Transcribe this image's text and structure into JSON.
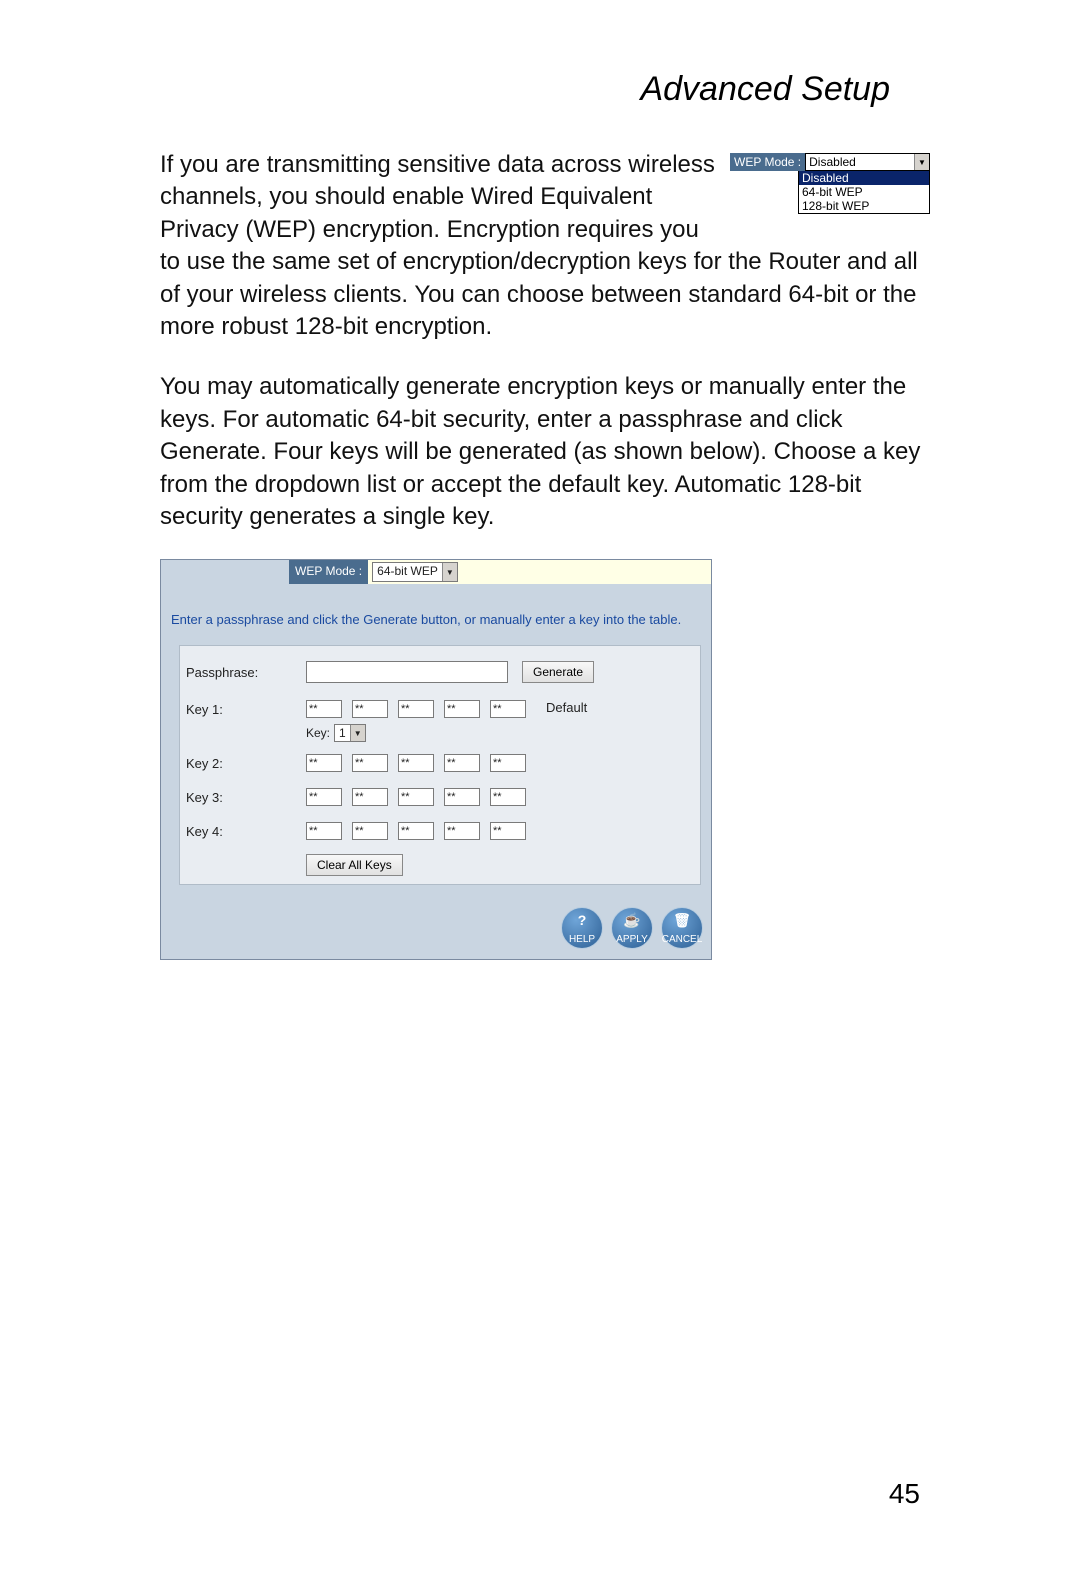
{
  "title": "Advanced Setup",
  "para1": "If you are transmitting sensitive data across wireless channels, you should enable Wired Equivalent Privacy (WEP) encryption. Encryption requires you to use the same set of encryption/decryption keys for the Router and all of your wireless clients. You can choose between standard 64-bit or the more robust 128-bit encryption.",
  "para2": "You may automatically generate encryption keys or manually enter the keys. For automatic 64-bit security, enter a passphrase and click Generate. Four keys will be generated (as shown below). Choose a key from the dropdown list or accept the default key. Automatic 128-bit security generates a single key.",
  "inset": {
    "label": "WEP Mode :",
    "selected": "Disabled",
    "options": [
      "Disabled",
      "64-bit WEP",
      "128-bit WEP"
    ]
  },
  "panel": {
    "wep_label": "WEP Mode :",
    "wep_value": "64-bit WEP",
    "instruction": "Enter a passphrase and click the Generate button, or manually enter a key into the table.",
    "labels": {
      "passphrase": "Passphrase:",
      "key1": "Key 1:",
      "key2": "Key 2:",
      "key3": "Key 3:",
      "key4": "Key 4:",
      "default": "Default",
      "key_select_label": "Key:",
      "key_select_value": "1"
    },
    "buttons": {
      "generate": "Generate",
      "clear": "Clear All Keys",
      "help": "HELP",
      "apply": "APPLY",
      "cancel": "CANCEL"
    },
    "passphrase_value": "",
    "keys": [
      [
        "**",
        "**",
        "**",
        "**",
        "**"
      ],
      [
        "**",
        "**",
        "**",
        "**",
        "**"
      ],
      [
        "**",
        "**",
        "**",
        "**",
        "**"
      ],
      [
        "**",
        "**",
        "**",
        "**",
        "**"
      ]
    ]
  },
  "page_number": "45"
}
